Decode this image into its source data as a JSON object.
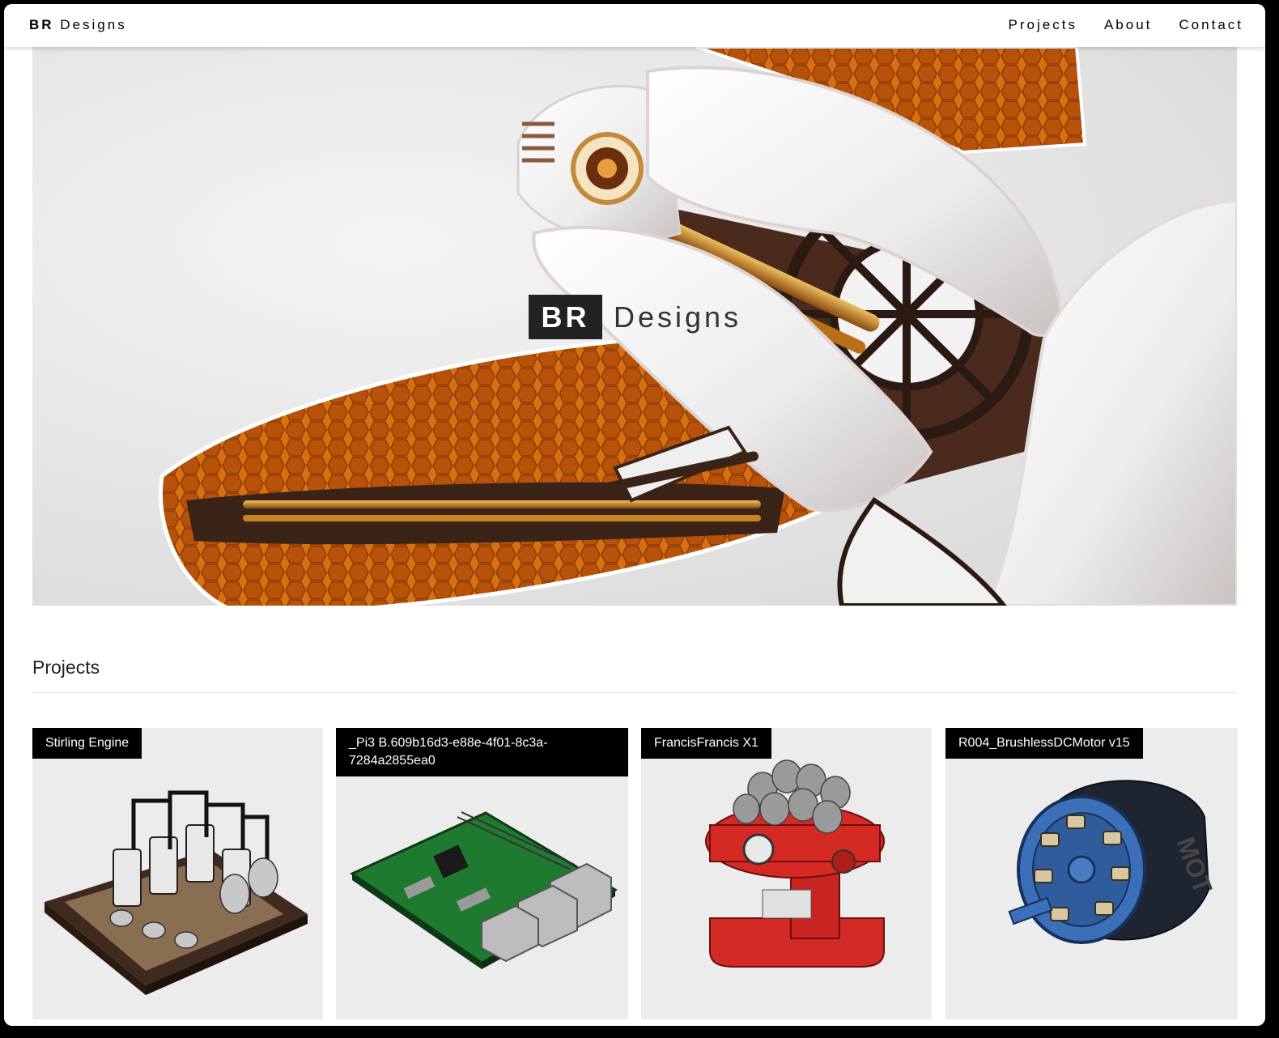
{
  "navbar": {
    "brand_bold": "BR",
    "brand_rest": "Designs",
    "links": [
      "Projects",
      "About",
      "Contact"
    ]
  },
  "hero": {
    "logo_box": "BR",
    "logo_word": "Designs"
  },
  "projects": {
    "title": "Projects",
    "items": [
      {
        "label": "Stirling Engine",
        "icon": "stirling-engine-render"
      },
      {
        "label": "_Pi3 B.609b16d3-e88e-4f01-8c3a-7284a2855ea0",
        "icon": "raspberry-pi-render"
      },
      {
        "label": "FrancisFrancis X1",
        "icon": "espresso-machine-render"
      },
      {
        "label": "R004_BrushlessDCMotor v15",
        "icon": "brushless-motor-render"
      }
    ]
  },
  "colors": {
    "accent_orange": "#d9700f",
    "label_bg": "#000000",
    "card_bg": "#ececec"
  }
}
